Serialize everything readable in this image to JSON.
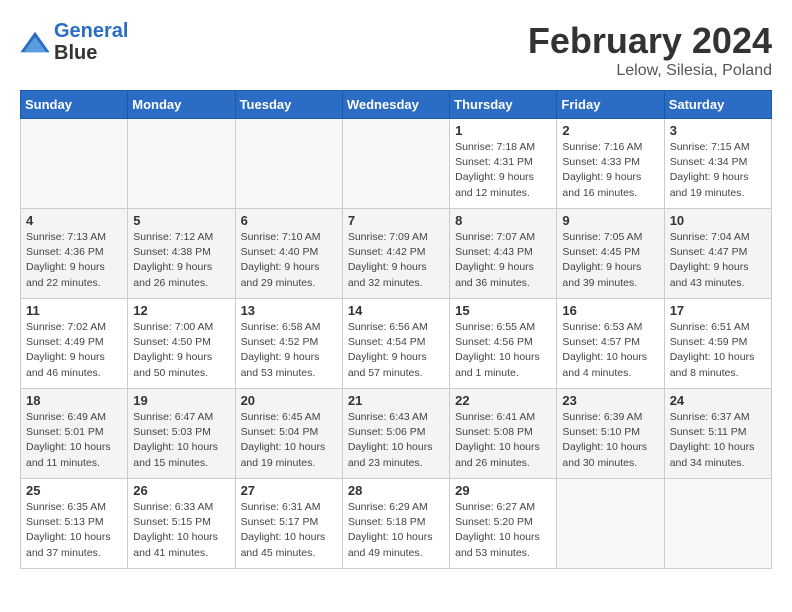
{
  "header": {
    "logo_line1": "General",
    "logo_line2": "Blue",
    "month": "February 2024",
    "location": "Lelow, Silesia, Poland"
  },
  "days_of_week": [
    "Sunday",
    "Monday",
    "Tuesday",
    "Wednesday",
    "Thursday",
    "Friday",
    "Saturday"
  ],
  "weeks": [
    [
      {
        "day": "",
        "info": ""
      },
      {
        "day": "",
        "info": ""
      },
      {
        "day": "",
        "info": ""
      },
      {
        "day": "",
        "info": ""
      },
      {
        "day": "1",
        "info": "Sunrise: 7:18 AM\nSunset: 4:31 PM\nDaylight: 9 hours\nand 12 minutes."
      },
      {
        "day": "2",
        "info": "Sunrise: 7:16 AM\nSunset: 4:33 PM\nDaylight: 9 hours\nand 16 minutes."
      },
      {
        "day": "3",
        "info": "Sunrise: 7:15 AM\nSunset: 4:34 PM\nDaylight: 9 hours\nand 19 minutes."
      }
    ],
    [
      {
        "day": "4",
        "info": "Sunrise: 7:13 AM\nSunset: 4:36 PM\nDaylight: 9 hours\nand 22 minutes."
      },
      {
        "day": "5",
        "info": "Sunrise: 7:12 AM\nSunset: 4:38 PM\nDaylight: 9 hours\nand 26 minutes."
      },
      {
        "day": "6",
        "info": "Sunrise: 7:10 AM\nSunset: 4:40 PM\nDaylight: 9 hours\nand 29 minutes."
      },
      {
        "day": "7",
        "info": "Sunrise: 7:09 AM\nSunset: 4:42 PM\nDaylight: 9 hours\nand 32 minutes."
      },
      {
        "day": "8",
        "info": "Sunrise: 7:07 AM\nSunset: 4:43 PM\nDaylight: 9 hours\nand 36 minutes."
      },
      {
        "day": "9",
        "info": "Sunrise: 7:05 AM\nSunset: 4:45 PM\nDaylight: 9 hours\nand 39 minutes."
      },
      {
        "day": "10",
        "info": "Sunrise: 7:04 AM\nSunset: 4:47 PM\nDaylight: 9 hours\nand 43 minutes."
      }
    ],
    [
      {
        "day": "11",
        "info": "Sunrise: 7:02 AM\nSunset: 4:49 PM\nDaylight: 9 hours\nand 46 minutes."
      },
      {
        "day": "12",
        "info": "Sunrise: 7:00 AM\nSunset: 4:50 PM\nDaylight: 9 hours\nand 50 minutes."
      },
      {
        "day": "13",
        "info": "Sunrise: 6:58 AM\nSunset: 4:52 PM\nDaylight: 9 hours\nand 53 minutes."
      },
      {
        "day": "14",
        "info": "Sunrise: 6:56 AM\nSunset: 4:54 PM\nDaylight: 9 hours\nand 57 minutes."
      },
      {
        "day": "15",
        "info": "Sunrise: 6:55 AM\nSunset: 4:56 PM\nDaylight: 10 hours\nand 1 minute."
      },
      {
        "day": "16",
        "info": "Sunrise: 6:53 AM\nSunset: 4:57 PM\nDaylight: 10 hours\nand 4 minutes."
      },
      {
        "day": "17",
        "info": "Sunrise: 6:51 AM\nSunset: 4:59 PM\nDaylight: 10 hours\nand 8 minutes."
      }
    ],
    [
      {
        "day": "18",
        "info": "Sunrise: 6:49 AM\nSunset: 5:01 PM\nDaylight: 10 hours\nand 11 minutes."
      },
      {
        "day": "19",
        "info": "Sunrise: 6:47 AM\nSunset: 5:03 PM\nDaylight: 10 hours\nand 15 minutes."
      },
      {
        "day": "20",
        "info": "Sunrise: 6:45 AM\nSunset: 5:04 PM\nDaylight: 10 hours\nand 19 minutes."
      },
      {
        "day": "21",
        "info": "Sunrise: 6:43 AM\nSunset: 5:06 PM\nDaylight: 10 hours\nand 23 minutes."
      },
      {
        "day": "22",
        "info": "Sunrise: 6:41 AM\nSunset: 5:08 PM\nDaylight: 10 hours\nand 26 minutes."
      },
      {
        "day": "23",
        "info": "Sunrise: 6:39 AM\nSunset: 5:10 PM\nDaylight: 10 hours\nand 30 minutes."
      },
      {
        "day": "24",
        "info": "Sunrise: 6:37 AM\nSunset: 5:11 PM\nDaylight: 10 hours\nand 34 minutes."
      }
    ],
    [
      {
        "day": "25",
        "info": "Sunrise: 6:35 AM\nSunset: 5:13 PM\nDaylight: 10 hours\nand 37 minutes."
      },
      {
        "day": "26",
        "info": "Sunrise: 6:33 AM\nSunset: 5:15 PM\nDaylight: 10 hours\nand 41 minutes."
      },
      {
        "day": "27",
        "info": "Sunrise: 6:31 AM\nSunset: 5:17 PM\nDaylight: 10 hours\nand 45 minutes."
      },
      {
        "day": "28",
        "info": "Sunrise: 6:29 AM\nSunset: 5:18 PM\nDaylight: 10 hours\nand 49 minutes."
      },
      {
        "day": "29",
        "info": "Sunrise: 6:27 AM\nSunset: 5:20 PM\nDaylight: 10 hours\nand 53 minutes."
      },
      {
        "day": "",
        "info": ""
      },
      {
        "day": "",
        "info": ""
      }
    ]
  ]
}
